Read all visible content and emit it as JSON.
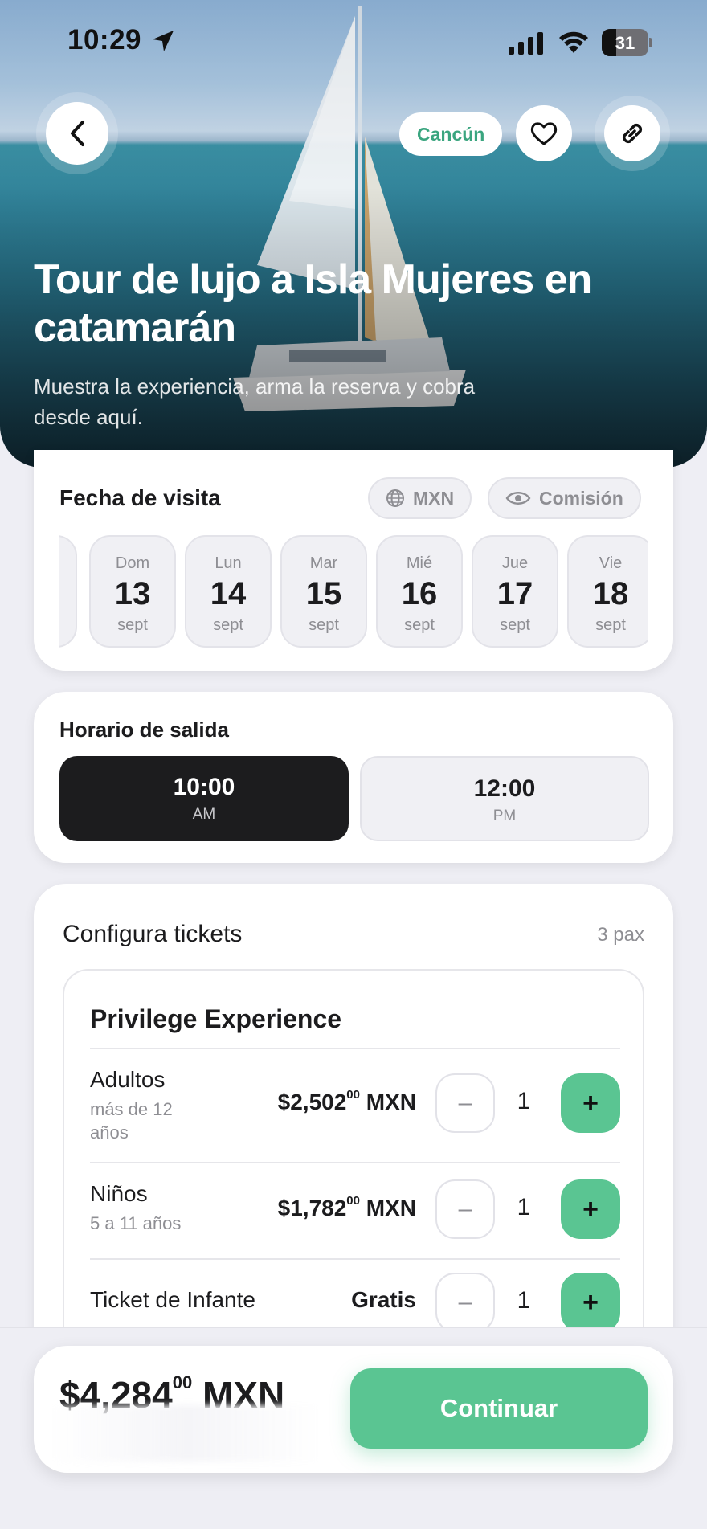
{
  "status_bar": {
    "time": "10:29",
    "battery": "31"
  },
  "hero": {
    "city": "Cancún",
    "title": "Tour de lujo a Isla Mujeres en catamarán",
    "subtitle": "Muestra la experiencia, arma la reserva y cobra desde aquí."
  },
  "date_section": {
    "label": "Fecha de visita",
    "currency_chip": "MXN",
    "commission_chip": "Comisión",
    "days": [
      {
        "dow": "Dom",
        "num": "13",
        "mon": "sept"
      },
      {
        "dow": "Lun",
        "num": "14",
        "mon": "sept"
      },
      {
        "dow": "Mar",
        "num": "15",
        "mon": "sept"
      },
      {
        "dow": "Mié",
        "num": "16",
        "mon": "sept"
      },
      {
        "dow": "Jue",
        "num": "17",
        "mon": "sept"
      },
      {
        "dow": "Vie",
        "num": "18",
        "mon": "sept"
      }
    ]
  },
  "time_section": {
    "label": "Horario de salida",
    "slots": [
      {
        "hour": "10:00",
        "period": "AM",
        "selected": true
      },
      {
        "hour": "12:00",
        "period": "PM",
        "selected": false
      }
    ]
  },
  "tickets": {
    "label": "Configura tickets",
    "pax": "3 pax",
    "product": "Privilege Experience",
    "rows": [
      {
        "title": "Adultos",
        "subtitle": "más de 12 años",
        "price_main": "$2,502",
        "price_cents": "00",
        "price_cur": "MXN",
        "qty": "1"
      },
      {
        "title": "Niños",
        "subtitle": "5 a 11 años",
        "price_main": "$1,782",
        "price_cents": "00",
        "price_cur": "MXN",
        "qty": "1"
      },
      {
        "title": "Ticket de Infante",
        "subtitle": "",
        "price_main": "Gratis",
        "price_cents": "",
        "price_cur": "",
        "qty": "1"
      }
    ],
    "minus_symbol": "–",
    "plus_symbol": "+"
  },
  "footer": {
    "total_main": "$4,284",
    "total_cents": "00",
    "total_cur": "MXN",
    "continue_label": "Continuar"
  },
  "colors": {
    "accent": "#5ac592",
    "dark": "#1c1c1e",
    "muted": "#8e8e93"
  }
}
